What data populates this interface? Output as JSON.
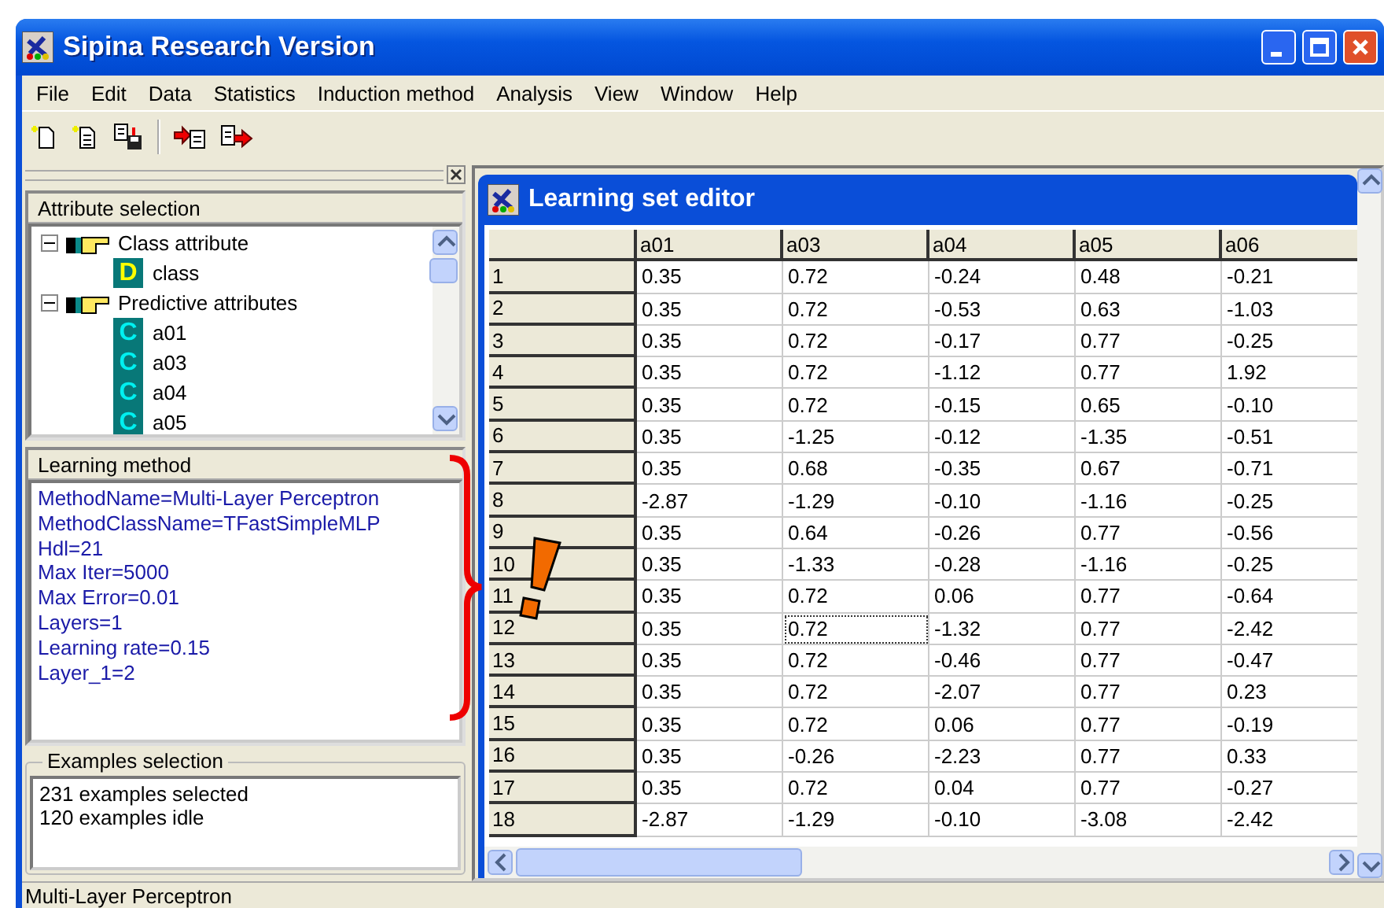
{
  "window": {
    "title": "Sipina Research Version"
  },
  "menu": [
    "File",
    "Edit",
    "Data",
    "Statistics",
    "Induction method",
    "Analysis",
    "View",
    "Window",
    "Help"
  ],
  "attribute_selection": {
    "title": "Attribute selection",
    "tree": [
      {
        "label": "Class attribute",
        "expanded": true,
        "children": [
          {
            "label": "class",
            "kind": "discrete",
            "type_letter": "D"
          }
        ]
      },
      {
        "label": "Predictive attributes",
        "expanded": true,
        "children": [
          {
            "label": "a01",
            "kind": "continuous",
            "type_letter": "C"
          },
          {
            "label": "a03",
            "kind": "continuous",
            "type_letter": "C"
          },
          {
            "label": "a04",
            "kind": "continuous",
            "type_letter": "C"
          },
          {
            "label": "a05",
            "kind": "continuous",
            "type_letter": "C"
          }
        ]
      }
    ]
  },
  "learning_method": {
    "title": "Learning method",
    "lines": [
      "MethodName=Multi-Layer Perceptron",
      "MethodClassName=TFastSimpleMLP",
      "Hdl=21",
      "Max Iter=5000",
      "Max Error=0.01",
      "Layers=1",
      "Learning rate=0.15",
      "Layer_1=2"
    ]
  },
  "examples_selection": {
    "title": "Examples selection",
    "lines": [
      "231 examples selected",
      "120 examples idle"
    ]
  },
  "learning_set_editor": {
    "title": "Learning set editor",
    "columns": [
      "a01",
      "a03",
      "a04",
      "a05",
      "a06"
    ],
    "rows": [
      {
        "label": "1",
        "cells": [
          {
            "text": "0.35",
            "focused": false
          },
          {
            "text": "0.72",
            "focused": false
          },
          {
            "text": "-0.24",
            "focused": false
          },
          {
            "text": "0.48",
            "focused": false
          },
          {
            "text": "-0.21",
            "focused": false
          }
        ]
      },
      {
        "label": "2",
        "cells": [
          {
            "text": "0.35",
            "focused": false
          },
          {
            "text": "0.72",
            "focused": false
          },
          {
            "text": "-0.53",
            "focused": false
          },
          {
            "text": "0.63",
            "focused": false
          },
          {
            "text": "-1.03",
            "focused": false
          }
        ]
      },
      {
        "label": "3",
        "cells": [
          {
            "text": "0.35",
            "focused": false
          },
          {
            "text": "0.72",
            "focused": false
          },
          {
            "text": "-0.17",
            "focused": false
          },
          {
            "text": "0.77",
            "focused": false
          },
          {
            "text": "-0.25",
            "focused": false
          }
        ]
      },
      {
        "label": "4",
        "cells": [
          {
            "text": "0.35",
            "focused": false
          },
          {
            "text": "0.72",
            "focused": false
          },
          {
            "text": "-1.12",
            "focused": false
          },
          {
            "text": "0.77",
            "focused": false
          },
          {
            "text": "1.92",
            "focused": false
          }
        ]
      },
      {
        "label": "5",
        "cells": [
          {
            "text": "0.35",
            "focused": false
          },
          {
            "text": "0.72",
            "focused": false
          },
          {
            "text": "-0.15",
            "focused": false
          },
          {
            "text": "0.65",
            "focused": false
          },
          {
            "text": "-0.10",
            "focused": false
          }
        ]
      },
      {
        "label": "6",
        "cells": [
          {
            "text": "0.35",
            "focused": false
          },
          {
            "text": "-1.25",
            "focused": false
          },
          {
            "text": "-0.12",
            "focused": false
          },
          {
            "text": "-1.35",
            "focused": false
          },
          {
            "text": "-0.51",
            "focused": false
          }
        ]
      },
      {
        "label": "7",
        "cells": [
          {
            "text": "0.35",
            "focused": false
          },
          {
            "text": "0.68",
            "focused": false
          },
          {
            "text": "-0.35",
            "focused": false
          },
          {
            "text": "0.67",
            "focused": false
          },
          {
            "text": "-0.71",
            "focused": false
          }
        ]
      },
      {
        "label": "8",
        "cells": [
          {
            "text": "-2.87",
            "focused": false
          },
          {
            "text": "-1.29",
            "focused": false
          },
          {
            "text": "-0.10",
            "focused": false
          },
          {
            "text": "-1.16",
            "focused": false
          },
          {
            "text": "-0.25",
            "focused": false
          }
        ]
      },
      {
        "label": "9",
        "cells": [
          {
            "text": "0.35",
            "focused": false
          },
          {
            "text": "0.64",
            "focused": false
          },
          {
            "text": "-0.26",
            "focused": false
          },
          {
            "text": "0.77",
            "focused": false
          },
          {
            "text": "-0.56",
            "focused": false
          }
        ]
      },
      {
        "label": "10",
        "cells": [
          {
            "text": "0.35",
            "focused": false
          },
          {
            "text": "-1.33",
            "focused": false
          },
          {
            "text": "-0.28",
            "focused": false
          },
          {
            "text": "-1.16",
            "focused": false
          },
          {
            "text": "-0.25",
            "focused": false
          }
        ]
      },
      {
        "label": "11",
        "cells": [
          {
            "text": "0.35",
            "focused": false
          },
          {
            "text": "0.72",
            "focused": false
          },
          {
            "text": "0.06",
            "focused": false
          },
          {
            "text": "0.77",
            "focused": false
          },
          {
            "text": "-0.64",
            "focused": false
          }
        ]
      },
      {
        "label": "12",
        "cells": [
          {
            "text": "0.35",
            "focused": false
          },
          {
            "text": "0.72",
            "focused": true
          },
          {
            "text": "-1.32",
            "focused": false
          },
          {
            "text": "0.77",
            "focused": false
          },
          {
            "text": "-2.42",
            "focused": false
          }
        ]
      },
      {
        "label": "13",
        "cells": [
          {
            "text": "0.35",
            "focused": false
          },
          {
            "text": "0.72",
            "focused": false
          },
          {
            "text": "-0.46",
            "focused": false
          },
          {
            "text": "0.77",
            "focused": false
          },
          {
            "text": "-0.47",
            "focused": false
          }
        ]
      },
      {
        "label": "14",
        "cells": [
          {
            "text": "0.35",
            "focused": false
          },
          {
            "text": "0.72",
            "focused": false
          },
          {
            "text": "-2.07",
            "focused": false
          },
          {
            "text": "0.77",
            "focused": false
          },
          {
            "text": "0.23",
            "focused": false
          }
        ]
      },
      {
        "label": "15",
        "cells": [
          {
            "text": "0.35",
            "focused": false
          },
          {
            "text": "0.72",
            "focused": false
          },
          {
            "text": "0.06",
            "focused": false
          },
          {
            "text": "0.77",
            "focused": false
          },
          {
            "text": "-0.19",
            "focused": false
          }
        ]
      },
      {
        "label": "16",
        "cells": [
          {
            "text": "0.35",
            "focused": false
          },
          {
            "text": "-0.26",
            "focused": false
          },
          {
            "text": "-2.23",
            "focused": false
          },
          {
            "text": "0.77",
            "focused": false
          },
          {
            "text": "0.33",
            "focused": false
          }
        ]
      },
      {
        "label": "17",
        "cells": [
          {
            "text": "0.35",
            "focused": false
          },
          {
            "text": "0.72",
            "focused": false
          },
          {
            "text": "0.04",
            "focused": false
          },
          {
            "text": "0.77",
            "focused": false
          },
          {
            "text": "-0.27",
            "focused": false
          }
        ]
      },
      {
        "label": "18",
        "cells": [
          {
            "text": "-2.87",
            "focused": false
          },
          {
            "text": "-1.29",
            "focused": false
          },
          {
            "text": "-0.10",
            "focused": false
          },
          {
            "text": "-3.08",
            "focused": false
          },
          {
            "text": "-2.42",
            "focused": false
          }
        ]
      }
    ]
  },
  "status_bar": "Multi-Layer Perceptron"
}
